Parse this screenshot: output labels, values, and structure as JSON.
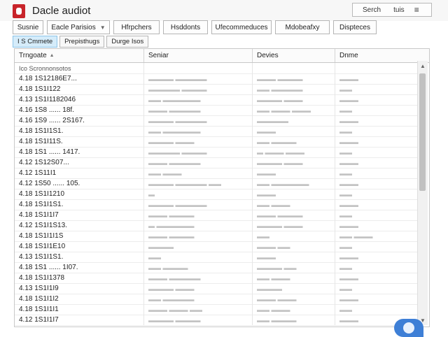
{
  "window": {
    "title": "Dacle audiot",
    "search_label": "Serch",
    "tab_label": "tuis",
    "menu_glyph": "≡"
  },
  "toolbar": [
    {
      "label": "Susnie",
      "has_caret": false
    },
    {
      "label": "Eacle Parisios",
      "has_caret": true
    },
    {
      "label": "Hfrpchers",
      "has_caret": false
    },
    {
      "label": "Hsddonts",
      "has_caret": false
    },
    {
      "label": "Ufecommeduces",
      "has_caret": false
    },
    {
      "label": "Mdobeafxy",
      "has_caret": false
    },
    {
      "label": "Dispteces",
      "has_caret": false
    }
  ],
  "subtabs": [
    {
      "label": "I S Cmmete",
      "active": true
    },
    {
      "label": "Prepisthugs",
      "active": false
    },
    {
      "label": "Durge Isos",
      "active": false
    }
  ],
  "table": {
    "columns": [
      "Trngoate",
      "Seniar",
      "Devies",
      "Dnme"
    ],
    "first_row": "Ico Scronnonsotos",
    "rows": [
      {
        "id": "4.18 1S12186E7...",
        "c2": "▬▬▬▬ ▬▬▬▬▬",
        "c3": "▬▬▬ ▬▬▬▬",
        "c4": "▬▬▬"
      },
      {
        "id": "4.18 1S1I122",
        "c2": "▬▬▬▬▬ ▬▬▬▬",
        "c3": "▬▬ ▬▬▬▬▬",
        "c4": "▬▬"
      },
      {
        "id": "4.13 1S1I1182046",
        "c2": "▬▬ ▬▬▬▬▬▬",
        "c3": "▬▬▬▬ ▬▬▬",
        "c4": "▬▬▬"
      },
      {
        "id": "4.16 1S8 ...... 18f.",
        "c2": "▬▬▬ ▬▬▬▬▬",
        "c3": "▬▬ ▬▬▬ ▬▬▬",
        "c4": "▬▬"
      },
      {
        "id": "4.16 1S9 ...... 2S167.",
        "c2": "▬▬▬▬ ▬▬▬▬▬",
        "c3": "▬▬▬▬▬",
        "c4": "▬▬▬"
      },
      {
        "id": "4.18 1S1I1S1.",
        "c2": "▬▬ ▬▬▬▬▬▬",
        "c3": "▬▬▬",
        "c4": "▬▬"
      },
      {
        "id": "4.18 1S1I11S.",
        "c2": "▬▬▬▬ ▬▬▬",
        "c3": "▬▬ ▬▬▬▬",
        "c4": "▬▬▬"
      },
      {
        "id": "4.18 1S1 ...... 1417.",
        "c2": "▬▬▬▬▬ ▬▬▬▬",
        "c3": "▬ ▬▬▬ ▬▬▬",
        "c4": "▬▬"
      },
      {
        "id": "4.12 1S12S07...",
        "c2": "▬▬▬ ▬▬▬▬▬",
        "c3": "▬▬▬▬ ▬▬▬",
        "c4": "▬▬▬"
      },
      {
        "id": "4.12 1S11I1",
        "c2": "▬▬ ▬▬▬",
        "c3": "▬▬▬",
        "c4": "▬▬"
      },
      {
        "id": "4.12 1S50 ...... 105.",
        "c2": "▬▬▬▬ ▬▬▬▬▬ ▬▬",
        "c3": "▬▬ ▬▬▬▬▬▬",
        "c4": "▬▬▬"
      },
      {
        "id": "4.18 1S1I1210",
        "c2": "▬",
        "c3": "▬▬▬",
        "c4": "▬▬"
      },
      {
        "id": "4.18 1S1I1S1.",
        "c2": "▬▬▬▬ ▬▬▬▬▬",
        "c3": "▬▬ ▬▬▬",
        "c4": "▬▬▬"
      },
      {
        "id": "4.18 1S1I1I7",
        "c2": "▬▬▬ ▬▬▬▬",
        "c3": "▬▬▬ ▬▬▬▬",
        "c4": "▬▬"
      },
      {
        "id": "4.12 1S1I1S13.",
        "c2": "▬ ▬▬▬▬▬▬",
        "c3": "▬▬▬▬ ▬▬▬",
        "c4": "▬▬▬"
      },
      {
        "id": "4.18 1S1I1I1S",
        "c2": "▬▬▬ ▬▬▬▬",
        "c3": "▬▬",
        "c4": "▬▬ ▬▬▬"
      },
      {
        "id": "4.18 1S1I1E10",
        "c2": "▬▬▬▬",
        "c3": "▬▬▬ ▬▬",
        "c4": "▬▬"
      },
      {
        "id": "4.13 1S1I1S1.",
        "c2": "▬▬",
        "c3": "▬▬▬",
        "c4": "▬▬▬"
      },
      {
        "id": "4.18 1S1 ...... 1I07.",
        "c2": "▬▬ ▬▬▬▬",
        "c3": "▬▬▬▬ ▬▬",
        "c4": "▬▬"
      },
      {
        "id": "4.18 1S1I1378",
        "c2": "▬▬▬ ▬▬▬▬▬",
        "c3": "▬▬ ▬▬▬",
        "c4": "▬▬▬"
      },
      {
        "id": "4.13 1S1I1I9",
        "c2": "▬▬▬▬ ▬▬▬",
        "c3": "▬▬▬▬",
        "c4": "▬▬"
      },
      {
        "id": "4.18 1S1I1I2",
        "c2": "▬▬ ▬▬▬▬▬",
        "c3": "▬▬▬ ▬▬▬",
        "c4": "▬▬▬"
      },
      {
        "id": "4.18 1S1I1I1",
        "c2": "▬▬▬ ▬▬▬ ▬▬",
        "c3": "▬▬ ▬▬▬",
        "c4": "▬▬"
      },
      {
        "id": "4.12 1S1I1I7",
        "c2": "▬▬▬▬ ▬▬▬▬",
        "c3": "▬▬ ▬▬▬▬",
        "c4": "▬▬▬"
      }
    ]
  },
  "colors": {
    "accent": "#3e7fd6",
    "logo": "#c8242a",
    "active_tab": "#d5ecfa"
  }
}
